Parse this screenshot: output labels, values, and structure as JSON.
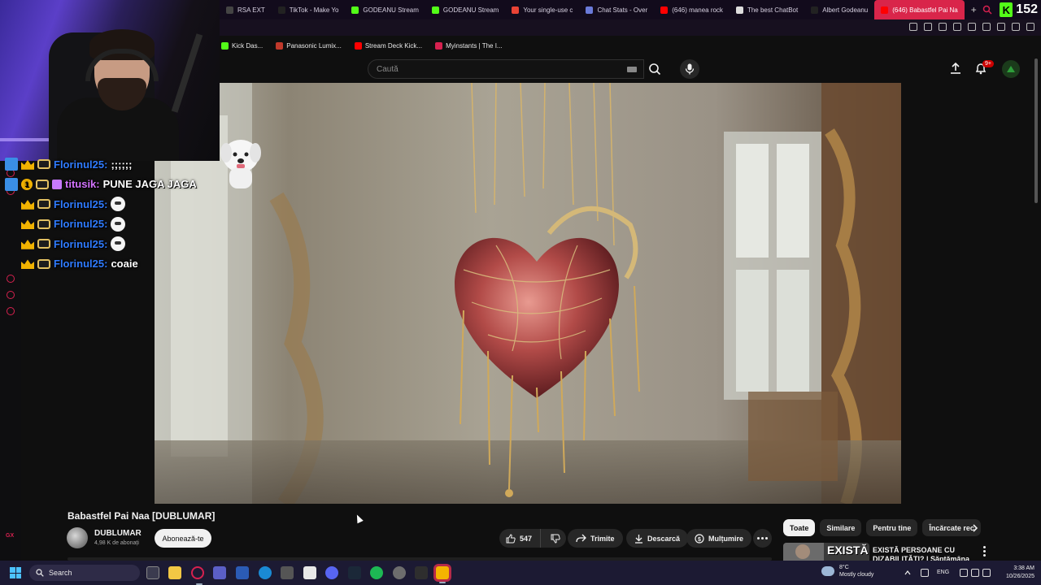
{
  "browser": {
    "tabs": [
      {
        "label": "RSA EXT",
        "color": "#444444"
      },
      {
        "label": "TikTok - Make Yo",
        "color": "#222222"
      },
      {
        "label": "GODEANU Stream",
        "color": "#53fc18"
      },
      {
        "label": "GODEANU Stream",
        "color": "#53fc18"
      },
      {
        "label": "Your single-use c",
        "color": "#ea4335"
      },
      {
        "label": "Chat Stats - Over",
        "color": "#6a7ad9"
      },
      {
        "label": "(646) manea rock",
        "color": "#ff0000"
      },
      {
        "label": "The best ChatBot",
        "color": "#dddddd"
      },
      {
        "label": "Albert Godeanu",
        "color": "#222222"
      },
      {
        "label": "(646) Babastfel Pai Na",
        "color": "#ff0000",
        "active": true
      }
    ],
    "kick_viewers": "152",
    "bookmarks": [
      {
        "label": "Kick Das...",
        "color": "#53fc18"
      },
      {
        "label": "Panasonic Lumix...",
        "color": "#c0392b"
      },
      {
        "label": "Stream Deck Kick...",
        "color": "#ff0000"
      },
      {
        "label": "Myinstants | The I...",
        "color": "#d6214f"
      }
    ]
  },
  "youtube": {
    "search_placeholder": "Caută",
    "notifications_badge": "9+",
    "video_title": "Babastfel Pai Naa [DUBLUMAR]",
    "channel_name": "DUBLUMAR",
    "subscribers": "4,98 K de abonați",
    "subscribe_label": "Abonează-te",
    "likes": "547",
    "share_label": "Trimite",
    "download_label": "Descarcă",
    "thanks_label": "Mulțumire",
    "chips": [
      "Toate",
      "Similare",
      "Pentru tine",
      "Încărcate rec"
    ],
    "recommendation": {
      "thumb_text": "EXISTĂ",
      "title": "EXISTĂ PERSOANE CU DIZABILITĂȚI? | Săptămâna pe"
    }
  },
  "chat": {
    "messages": [
      {
        "user": "Florinul25:",
        "msg": ";;;;;;",
        "badges": [
          "crown",
          "glasses"
        ]
      },
      {
        "user": "titusik:",
        "msg": "PUNE JAGA JAGA",
        "badges": [
          "one",
          "glasses",
          "gift"
        ],
        "pink": true
      },
      {
        "user": "Florinul25:",
        "msg": "",
        "badges": [
          "crown",
          "glasses"
        ],
        "emote": true
      },
      {
        "user": "Florinul25:",
        "msg": "",
        "badges": [
          "crown",
          "glasses"
        ],
        "emote": true
      },
      {
        "user": "Florinul25:",
        "msg": "",
        "badges": [
          "crown",
          "glasses"
        ],
        "emote": true
      },
      {
        "user": "Florinul25:",
        "msg": "coaie",
        "badges": [
          "crown",
          "glasses"
        ]
      }
    ]
  },
  "taskbar": {
    "search_label": "Search",
    "weather_temp": "8°C",
    "weather_desc": "Mostly cloudy",
    "language": "ENG",
    "time": "3:38 AM",
    "date": "10/26/2025"
  },
  "sidebar_label": "GX"
}
